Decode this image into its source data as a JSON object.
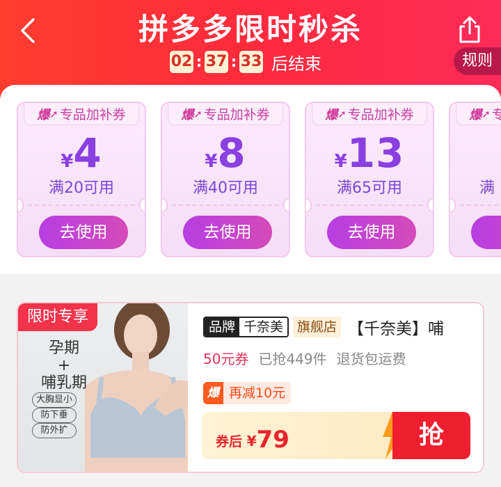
{
  "header": {
    "title": "拼多多限时秒杀",
    "countdown": {
      "hours": "02",
      "minutes": "37",
      "seconds": "33",
      "separator": ":",
      "suffix": "后结束"
    },
    "rules_label": "规则"
  },
  "coupons": [
    {
      "tag_hot": "爆",
      "tag_text": "专品加补券",
      "currency": "¥",
      "amount": "4",
      "condition": "满20可用",
      "button": "去使用"
    },
    {
      "tag_hot": "爆",
      "tag_text": "专品加补券",
      "currency": "¥",
      "amount": "8",
      "condition": "满40可用",
      "button": "去使用"
    },
    {
      "tag_hot": "爆",
      "tag_text": "专品加补券",
      "currency": "¥",
      "amount": "13",
      "condition": "满65可用",
      "button": "去使用"
    },
    {
      "tag_hot": "爆",
      "tag_text": "专品加补券",
      "currency": "¥",
      "amount": "",
      "condition": "满",
      "button": ""
    }
  ],
  "product": {
    "badge": "限时专享",
    "image_text": {
      "line1": "孕期",
      "line2": "+",
      "line3": "哺乳期",
      "pills": [
        "大胸显小",
        "防下垂",
        "防外扩"
      ]
    },
    "brand_key": "品牌",
    "brand_name": "千奈美",
    "store_type": "旗舰店",
    "title": "【千奈美】哺",
    "coupon_text": "50元券",
    "sold_text": "已抢449件",
    "return_text": "退货包运费",
    "extra_badge": "爆",
    "extra_text": "再减10元",
    "after_coupon_label": "券后",
    "currency": "¥",
    "price": "79",
    "buy_label": "抢"
  },
  "colors": {
    "header_red": "#ff2a3d",
    "coupon_purple": "#8a3fe0",
    "price_red": "#e8242e"
  },
  "icons": [
    "back-arrow-icon",
    "share-icon",
    "hot-flame-icon",
    "lightning-icon"
  ]
}
